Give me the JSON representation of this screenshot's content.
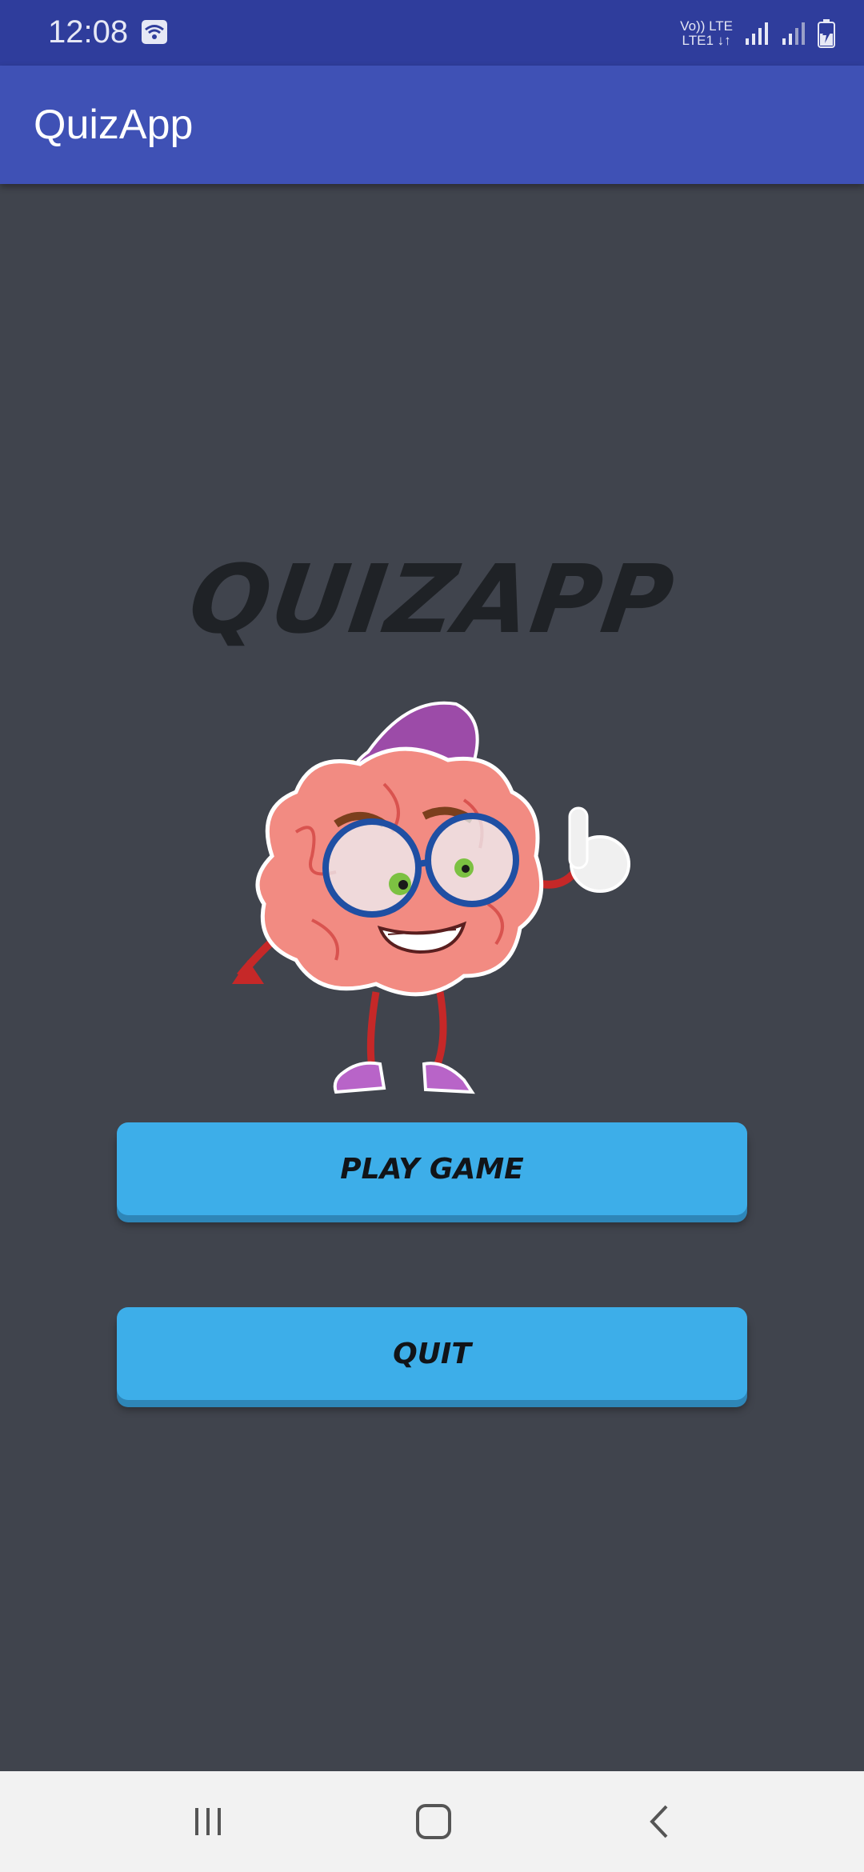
{
  "status_bar": {
    "time": "12:08",
    "network_line1": "Vo)) LTE",
    "network_line2": "LTE1 ↓↑",
    "icons": [
      "wifi-icon",
      "signal-icon",
      "signal-icon",
      "battery-charging-icon"
    ]
  },
  "app_bar": {
    "title": "QuizApp"
  },
  "main": {
    "logo_text": "QUIZAPP",
    "mascot": "brain-mascot-illustration",
    "play_button_label": "PLAY GAME",
    "quit_button_label": "QUIT"
  },
  "nav_bar": {
    "icons": [
      "recent-apps-icon",
      "home-icon",
      "back-icon"
    ]
  },
  "colors": {
    "status_bar": "#2f3d9c",
    "app_bar": "#3f51b5",
    "background": "#40444d",
    "button": "#3daee9",
    "nav_bar": "#f2f2f2"
  }
}
